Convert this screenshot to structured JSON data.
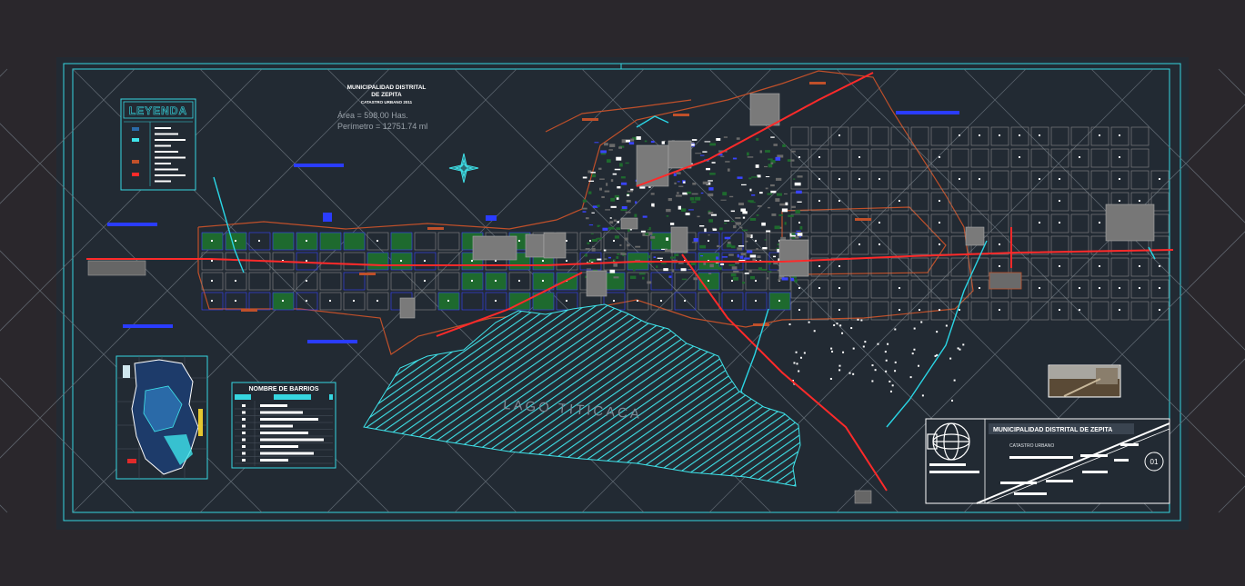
{
  "header": {
    "title_line1": "MUNICIPALIDAD DISTRITAL",
    "title_line2": "DE ZEPITA",
    "subtitle": "CATASTRO URBANO 2011",
    "area": "Área = 598.00 Has.",
    "perimeter": "Perímetro = 12751.74 ml"
  },
  "lake_label": "LAGO  TITICACA",
  "legend_title": "LEYENDA",
  "barrios_title": "NOMBRE DE BARRIOS",
  "title_block": {
    "entity": "MUNICIPALIDAD DISTRITAL DE ZEPITA",
    "subject": "CATASTRO URBANO",
    "sheet": "01"
  },
  "colors": {
    "background": "#2a272c",
    "sheet": "#222a33",
    "border": "#36d6e0",
    "lake": "#3fe3ea",
    "road": "#ff2a2a",
    "block": "#8a8a8a",
    "block_blue": "#3a44ff",
    "plot": "#1e6a2e",
    "building": "#ffffff",
    "perimeter": "#c0502a",
    "water": "#2ad6e6"
  },
  "icons": {
    "north": "compass-rose-icon",
    "logo": "globe-logo-icon",
    "photo": "site-photo-thumbnail"
  }
}
